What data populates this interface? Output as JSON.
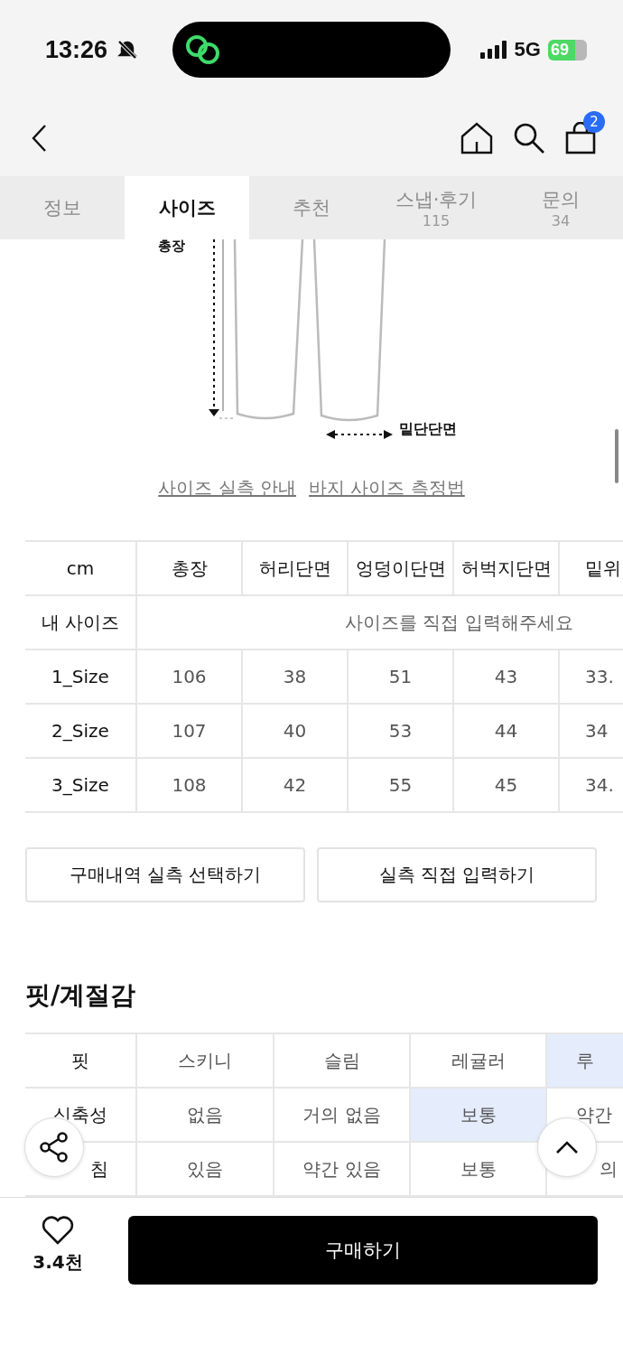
{
  "status_bar": {
    "time": "13:26",
    "network": "5G",
    "battery": "69"
  },
  "header": {
    "cart_count": "2"
  },
  "tabs": [
    {
      "label": "정보",
      "selected": false
    },
    {
      "label": "사이즈",
      "selected": true
    },
    {
      "label": "추천",
      "selected": false
    },
    {
      "label": "스냅·후기",
      "count": "115",
      "selected": false
    },
    {
      "label": "문의",
      "count": "34",
      "selected": false
    }
  ],
  "diagram": {
    "length_label": "총장",
    "hem_label": "밑단단면"
  },
  "guide_links": [
    "사이즈 실측 안내",
    "바지 사이즈 측정법"
  ],
  "size_table": {
    "columns": [
      "cm",
      "총장",
      "허리단면",
      "엉덩이단면",
      "허벅지단면",
      "밑위"
    ],
    "my_size": {
      "label": "내 사이즈",
      "placeholder": "사이즈를 직접 입력해주세요"
    },
    "rows": [
      {
        "size": "1_Size",
        "values": [
          "106",
          "38",
          "51",
          "43",
          "33."
        ]
      },
      {
        "size": "2_Size",
        "values": [
          "107",
          "40",
          "53",
          "44",
          "34"
        ]
      },
      {
        "size": "3_Size",
        "values": [
          "108",
          "42",
          "55",
          "45",
          "34."
        ]
      }
    ]
  },
  "size_buttons": [
    "구매내역 실측 선택하기",
    "실측 직접 입력하기"
  ],
  "fit_section": {
    "title": "핏/계절감",
    "rows": [
      {
        "label": "핏",
        "options": [
          {
            "text": "스키니",
            "selected": false
          },
          {
            "text": "슬림",
            "selected": false
          },
          {
            "text": "레귤러",
            "selected": false
          },
          {
            "text": "루",
            "selected": true
          }
        ]
      },
      {
        "label": "신축성",
        "options": [
          {
            "text": "없음",
            "selected": false
          },
          {
            "text": "거의 없음",
            "selected": false
          },
          {
            "text": "보통",
            "selected": true
          },
          {
            "text": "약간",
            "selected": false
          }
        ]
      },
      {
        "label": "침",
        "options": [
          {
            "text": "있음",
            "selected": false
          },
          {
            "text": "약간 있음",
            "selected": false
          },
          {
            "text": "보통",
            "selected": false
          },
          {
            "text": "의",
            "selected": false
          }
        ]
      }
    ]
  },
  "bottom_bar": {
    "likes": "3.4천",
    "buy_button": "구매하기"
  }
}
